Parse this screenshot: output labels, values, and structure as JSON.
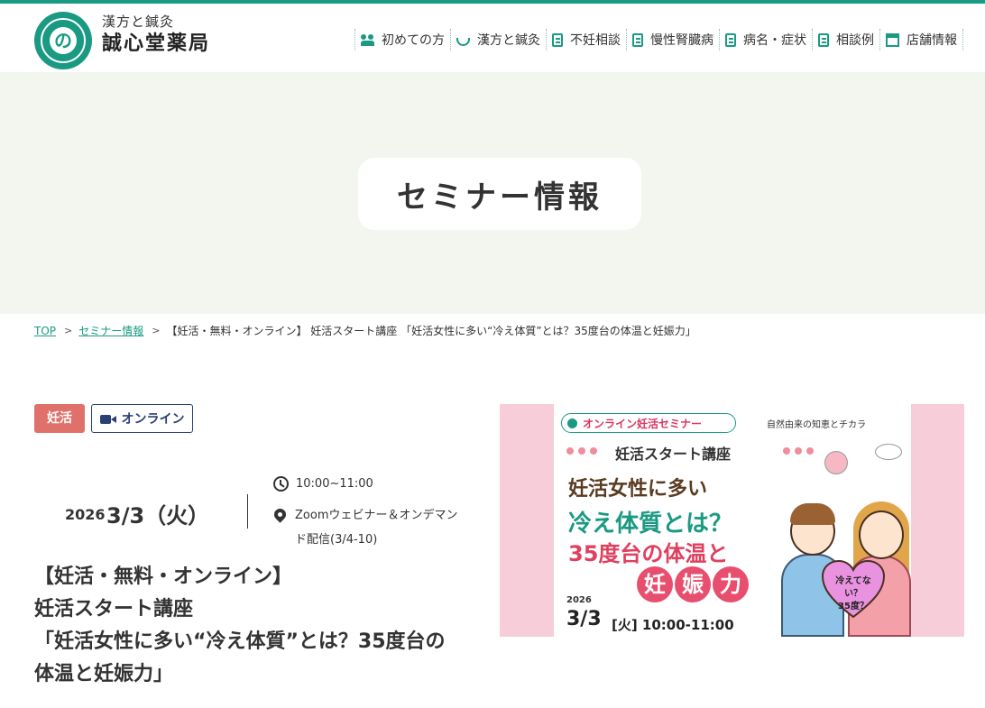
{
  "brand": {
    "logo_glyph": "の",
    "subtitle": "漢方と鍼灸",
    "name": "誠心堂薬局"
  },
  "nav": {
    "items": [
      {
        "label": "初めての方",
        "icon": "people-icon"
      },
      {
        "label": "漢方と鍼灸",
        "icon": "bowl-icon"
      },
      {
        "label": "不妊相談",
        "icon": "document-icon"
      },
      {
        "label": "慢性腎臓病",
        "icon": "document-icon"
      },
      {
        "label": "病名・症状",
        "icon": "document-icon"
      },
      {
        "label": "相談例",
        "icon": "document-icon"
      },
      {
        "label": "店舗情報",
        "icon": "shop-icon"
      }
    ]
  },
  "hero": {
    "title": "セミナー情報"
  },
  "breadcrumb": {
    "items": [
      "TOP",
      "セミナー情報"
    ],
    "current": "【妊活・無料・オンライン】 妊活スタート講座 「妊活女性に多い“冷え体質”とは？35度台の体温と妊娠力」"
  },
  "event": {
    "tags": {
      "category": "妊活",
      "format": "オンライン"
    },
    "year": "2026",
    "day": "3/3（火）",
    "time": "10:00~11:00",
    "place": "Zoomウェビナー＆オンデマンド配信(3/4-10)",
    "title_line1": "【妊活・無料・オンライン】",
    "title_line2": "妊活スタート講座",
    "title_line3": "「妊活女性に多い“冷え体質”とは？35度台の体温と妊娠力」"
  },
  "banner": {
    "pill": "オンライン妊活セミナー",
    "catch": "自然由来の知恵とチカラ",
    "course": "妊活スタート講座",
    "line1": "妊活女性に多い",
    "line2": "冷え体質とは？",
    "line3": "35度台の体温と",
    "power": [
      "妊",
      "娠",
      "力"
    ],
    "year": "2026",
    "date": "3/3",
    "time": "[火] 10:00-11:00",
    "heart_text_1": "冷えてない？",
    "heart_text_2": "35度？"
  },
  "colors": {
    "brand_green": "#1a9a82",
    "tag_pink": "#e0706a",
    "tag_navy": "#2a3f73",
    "hero_bg": "#f2f6ee",
    "banner_pink": "#f7cdd9"
  }
}
